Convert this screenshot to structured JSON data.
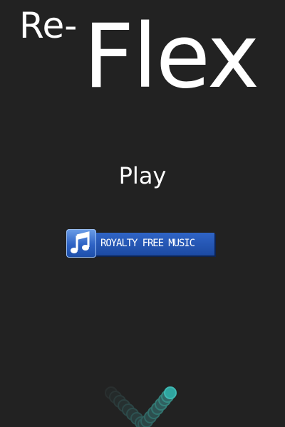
{
  "title": {
    "prefix": "Re-",
    "main": "Flex"
  },
  "menu": {
    "play_label": "Play"
  },
  "music_button": {
    "label": "ROYALTY FREE MUSIC",
    "icon": "music-note-icon"
  },
  "colors": {
    "background": "#222222",
    "text": "#ffffff",
    "music_button_blue": "#2d62c4",
    "snake_head": "#2fa5a0",
    "snake_tail": "#1f4a48"
  }
}
